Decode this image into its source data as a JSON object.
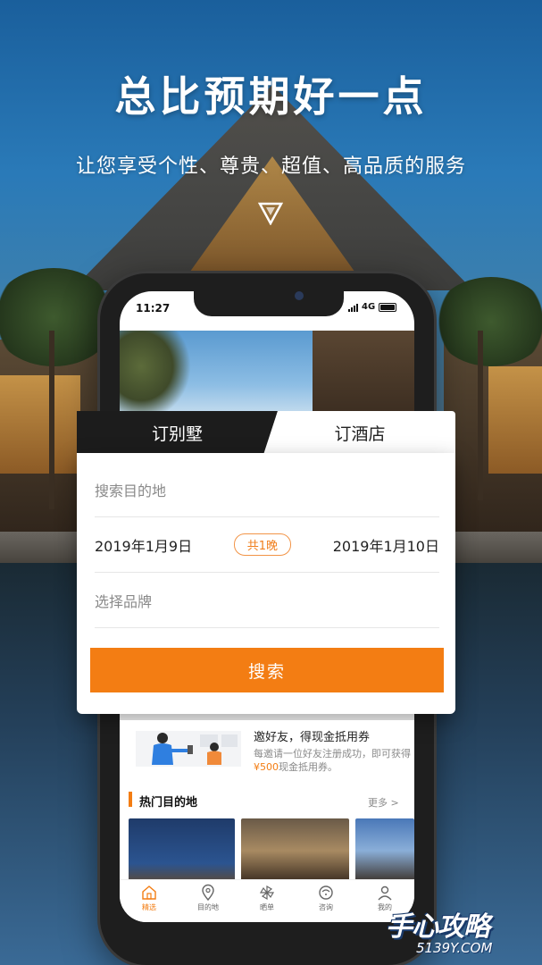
{
  "hero": {
    "headline": "总比预期好一点",
    "subline": "让您享受个性、尊贵、超值、高品质的服务"
  },
  "status_bar": {
    "time": "11:27",
    "network": "4G"
  },
  "booking": {
    "tabs": [
      {
        "label": "订别墅",
        "active": false
      },
      {
        "label": "订酒店",
        "active": true
      }
    ],
    "destination_placeholder": "搜索目的地",
    "checkin_date": "2019年1月9日",
    "nights": "共1晚",
    "checkout_date": "2019年1月10日",
    "brand_placeholder": "选择品牌",
    "search_label": "搜索"
  },
  "invite": {
    "title": "邀好友，得现金抵用券",
    "desc_before": "每邀请一位好友注册成功，即可获得",
    "amount": "¥500",
    "desc_after": "现金抵用券。"
  },
  "hot": {
    "title": "热门目的地",
    "more": "更多 >"
  },
  "tabbar": {
    "items": [
      {
        "label": "精选",
        "icon": "home-icon",
        "active": true
      },
      {
        "label": "目的地",
        "icon": "location-pin-icon",
        "active": false
      },
      {
        "label": "晒单",
        "icon": "pinwheel-icon",
        "active": false
      },
      {
        "label": "咨询",
        "icon": "chat-icon",
        "active": false
      },
      {
        "label": "我的",
        "icon": "user-icon",
        "active": false
      }
    ]
  },
  "watermark": {
    "main": "手心攻略",
    "sub": "5139Y.COM"
  },
  "colors": {
    "accent": "#f37d13",
    "dark_tab": "#1c1c1c"
  }
}
